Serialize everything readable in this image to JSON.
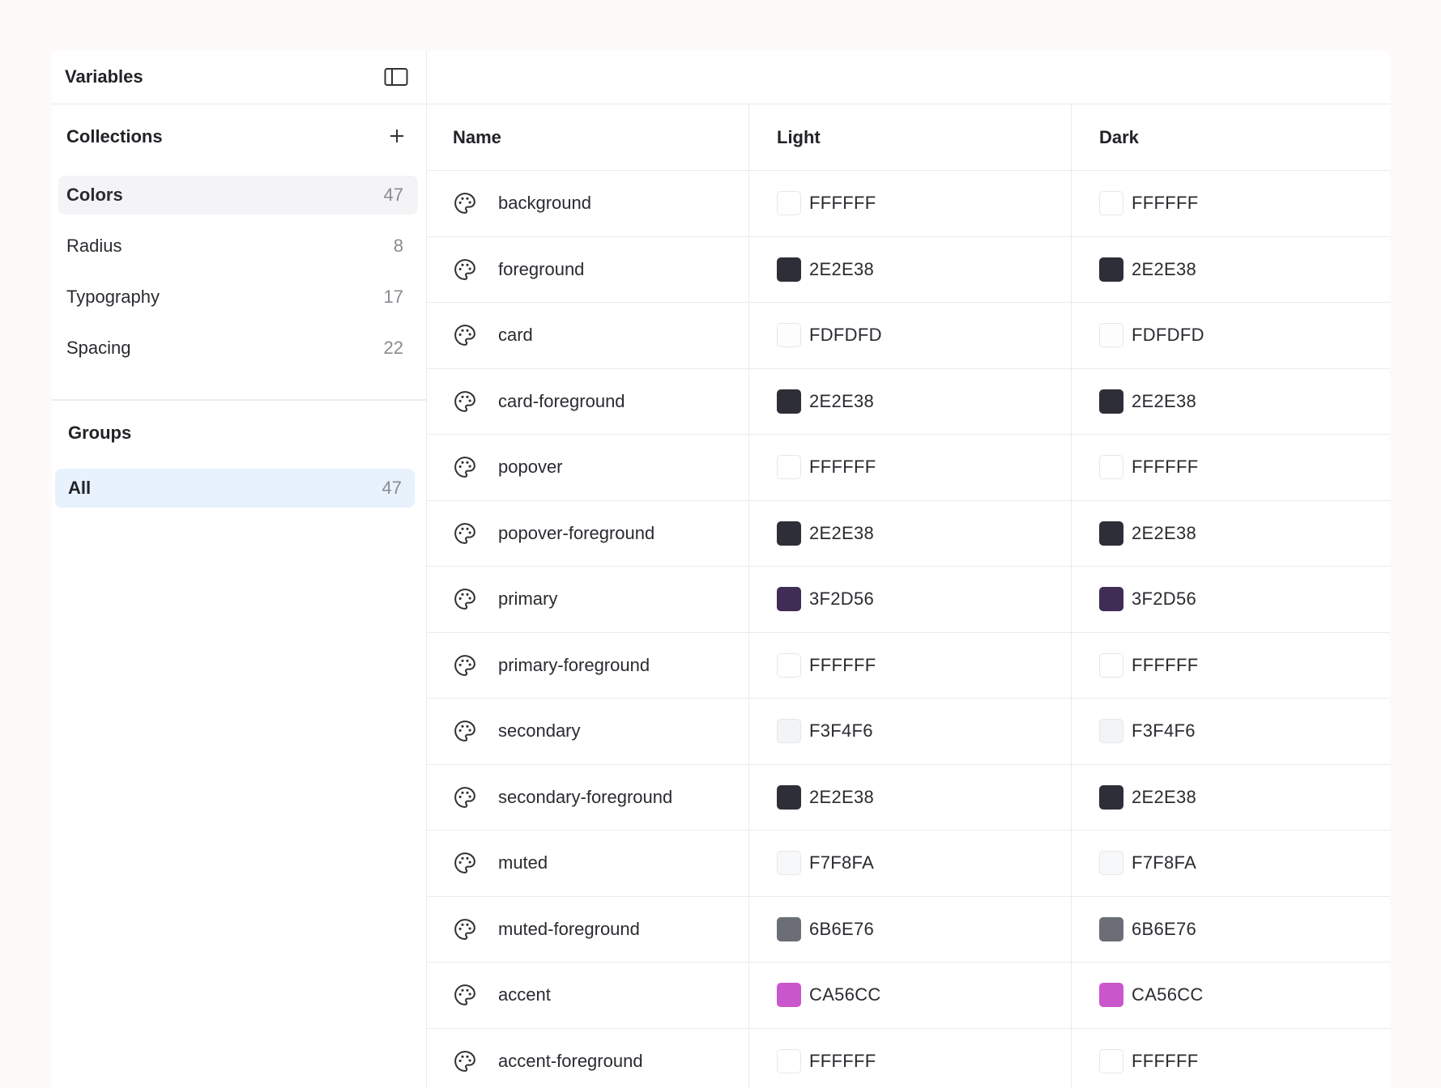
{
  "sidebar": {
    "title": "Variables",
    "collections_title": "Collections",
    "collections": [
      {
        "label": "Colors",
        "count": "47"
      },
      {
        "label": "Radius",
        "count": "8"
      },
      {
        "label": "Typography",
        "count": "17"
      },
      {
        "label": "Spacing",
        "count": "22"
      }
    ],
    "groups_title": "Groups",
    "groups": [
      {
        "label": "All",
        "count": "47"
      }
    ]
  },
  "table": {
    "headers": {
      "name": "Name",
      "light": "Light",
      "dark": "Dark"
    },
    "rows": [
      {
        "name": "background",
        "light": "FFFFFF",
        "dark": "FFFFFF"
      },
      {
        "name": "foreground",
        "light": "2E2E38",
        "dark": "2E2E38"
      },
      {
        "name": "card",
        "light": "FDFDFD",
        "dark": "FDFDFD"
      },
      {
        "name": "card-foreground",
        "light": "2E2E38",
        "dark": "2E2E38"
      },
      {
        "name": "popover",
        "light": "FFFFFF",
        "dark": "FFFFFF"
      },
      {
        "name": "popover-foreground",
        "light": "2E2E38",
        "dark": "2E2E38"
      },
      {
        "name": "primary",
        "light": "3F2D56",
        "dark": "3F2D56"
      },
      {
        "name": "primary-foreground",
        "light": "FFFFFF",
        "dark": "FFFFFF"
      },
      {
        "name": "secondary",
        "light": "F3F4F6",
        "dark": "F3F4F6"
      },
      {
        "name": "secondary-foreground",
        "light": "2E2E38",
        "dark": "2E2E38"
      },
      {
        "name": "muted",
        "light": "F7F8FA",
        "dark": "F7F8FA"
      },
      {
        "name": "muted-foreground",
        "light": "6B6E76",
        "dark": "6B6E76"
      },
      {
        "name": "accent",
        "light": "CA56CC",
        "dark": "CA56CC"
      },
      {
        "name": "accent-foreground",
        "light": "FFFFFF",
        "dark": "FFFFFF"
      }
    ]
  },
  "icons": {
    "sidebar_toggle": "sidebar-toggle-icon",
    "add": "plus-icon",
    "variable": "palette-icon"
  }
}
